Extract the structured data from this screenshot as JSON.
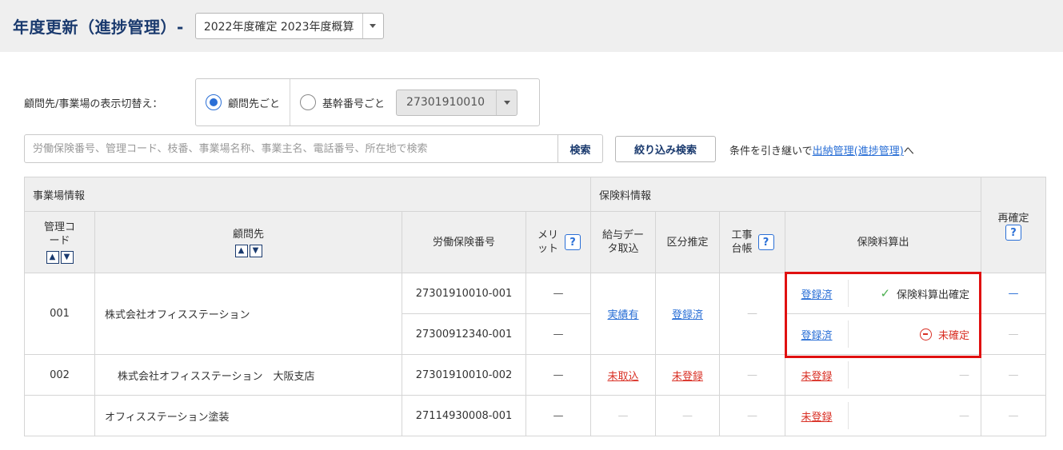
{
  "header": {
    "title": "年度更新（進捗管理）-",
    "year_select": "2022年度確定 2023年度概算"
  },
  "toggle": {
    "label": "顧問先/事業場の表示切替え：",
    "option_client": "顧問先ごと",
    "option_base": "基幹番号ごと",
    "base_code": "27301910010"
  },
  "search": {
    "placeholder": "労働保険番号、管理コード、枝番、事業場名称、事業主名、電話番号、所在地で検索",
    "button": "検索",
    "filter_button": "絞り込み検索",
    "carry_text_pre": "条件を引き継いで",
    "carry_link": "出納管理(進捗管理)",
    "carry_text_post": "へ"
  },
  "table": {
    "group_jigyo": "事業場情報",
    "group_hoken": "保険料情報",
    "col_code": "管理コード",
    "col_client": "顧問先",
    "col_number": "労働保険番号",
    "col_merit": "メリット",
    "col_salary": "給与データ取込",
    "col_kubun": "区分推定",
    "col_kouji": "工事台帳",
    "col_calc": "保険料算出",
    "col_reconfirm": "再確定",
    "rows": [
      {
        "code": "001",
        "client": "株式会社オフィスステーション",
        "salary": "実績有",
        "kubun": "登録済",
        "kouji": "—",
        "subs": [
          {
            "number": "27301910010-001",
            "merit": "—",
            "calc_link": "登録済",
            "status": "保険料算出確定",
            "reconfirm": "—"
          },
          {
            "number": "27300912340-001",
            "merit": "—",
            "calc_link": "登録済",
            "status": "未確定",
            "reconfirm": "—"
          }
        ]
      },
      {
        "code": "002",
        "client": "株式会社オフィスステーション　大阪支店",
        "number": "27301910010-002",
        "merit": "—",
        "salary": "未取込",
        "kubun": "未登録",
        "kouji": "—",
        "calc_link": "未登録",
        "status": "—",
        "reconfirm": "—"
      },
      {
        "code": "",
        "client": "オフィスステーション塗装",
        "number": "27114930008-001",
        "merit": "—",
        "salary": "—",
        "kubun": "—",
        "kouji": "—",
        "calc_link": "未登録",
        "status": "—",
        "reconfirm": "—"
      }
    ]
  },
  "colors": {
    "title": "#1a3a6e",
    "link_blue": "#2a6fd6",
    "link_red": "#d93025",
    "highlight": "#e01010",
    "check_green": "#4caf50"
  },
  "icons": {
    "help": "?",
    "sort_up": "▲",
    "sort_down": "▼",
    "check": "✓"
  }
}
